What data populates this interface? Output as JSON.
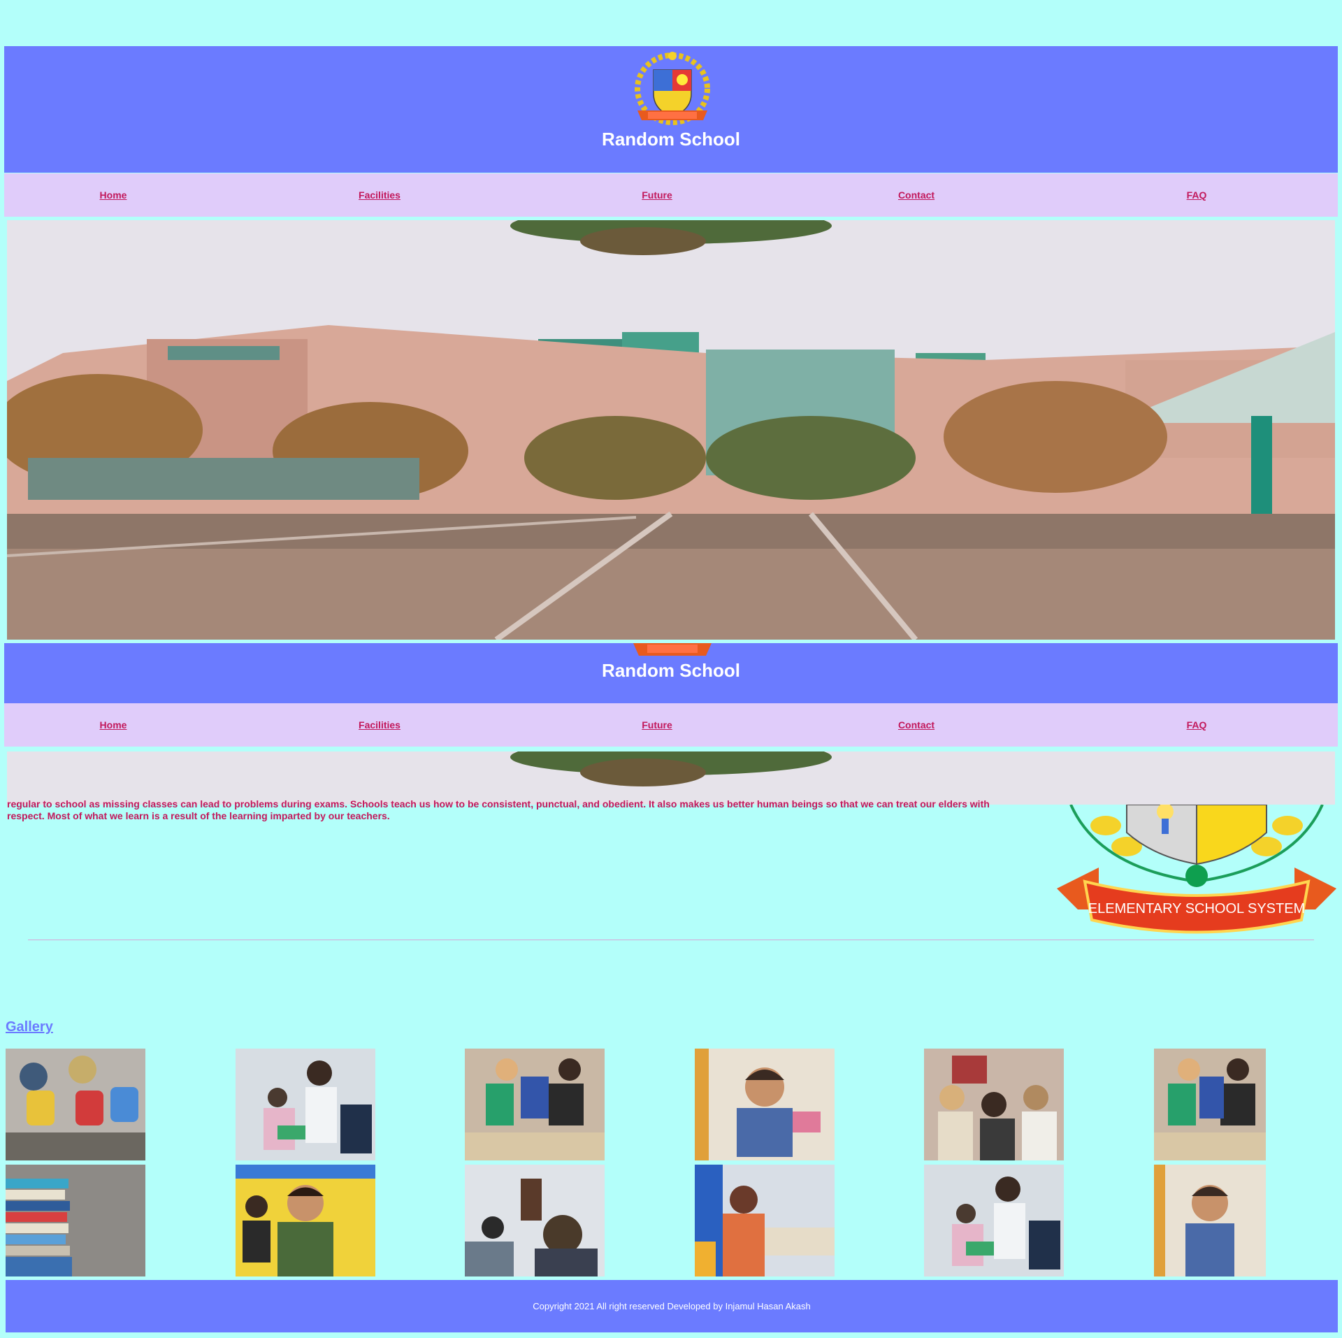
{
  "site": {
    "name": "Random School"
  },
  "nav": {
    "items": [
      "Home",
      "Facilities",
      "Future",
      "Contact",
      "FAQ"
    ]
  },
  "logo": {
    "ribbon_text": "ELEMENTARY SCHOOL SYSTEM"
  },
  "about": {
    "text": "regular to school as missing classes can lead to problems during exams. Schools teach us how to be consistent, punctual, and obedient. It also makes us better human beings so that we can treat our elders with respect. Most of what we learn is a result of the learning imparted by our teachers."
  },
  "gallery": {
    "title": "Gallery"
  },
  "footer": {
    "text": "Copyright 2021 All right reserved Developed by Injamul Hasan Akash"
  },
  "colors": {
    "background": "#b3fffa",
    "header": "#6b7bff",
    "nav": "#e0ccfa",
    "link": "#c2185b"
  }
}
